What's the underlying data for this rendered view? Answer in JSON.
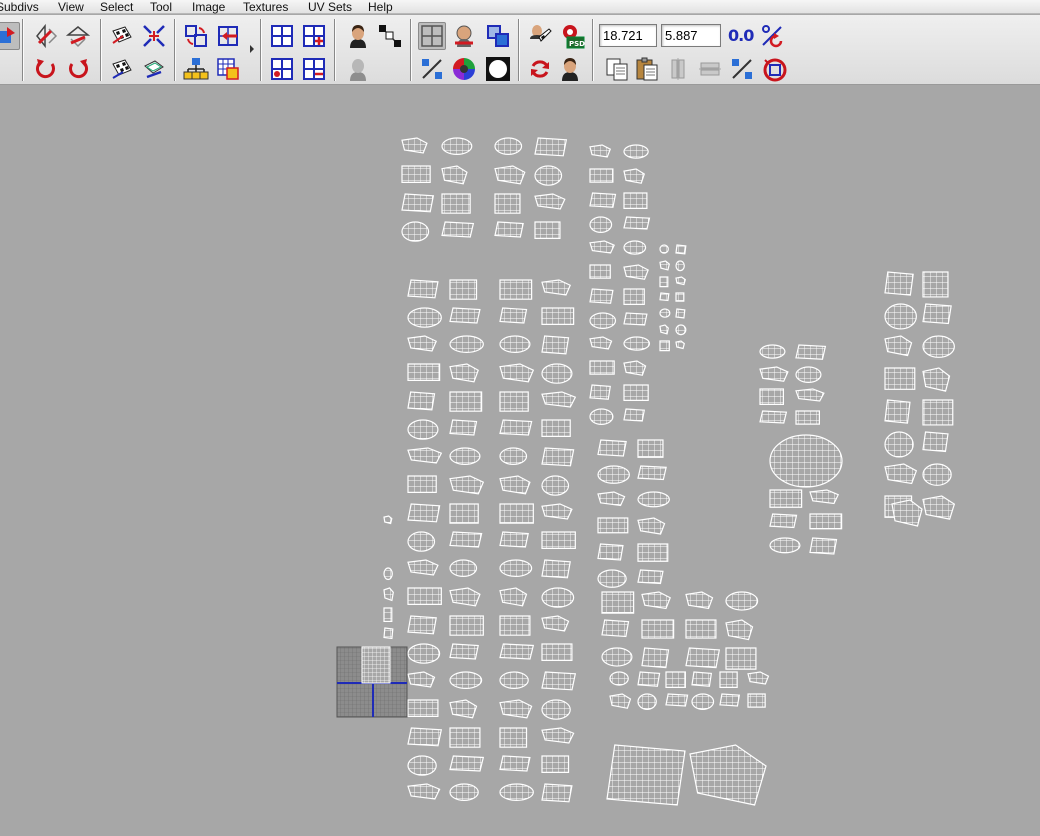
{
  "menubar": {
    "items": [
      "Subdivs",
      "View",
      "Select",
      "Tool",
      "Image",
      "Textures",
      "UV Sets",
      "Help"
    ]
  },
  "toolbar": {
    "coord_u": "18.721",
    "coord_v": "5.887",
    "value_label": "0.0",
    "icons": {
      "row1": [
        "select-mode-icon",
        "flip-u-icon",
        "flip-v-icon",
        "checker-map-icon",
        "shrink-icon",
        "cycle-uv-icon",
        "move-to-shell-icon",
        "grid-icon",
        "grid-add-icon",
        "portrait-icon",
        "align-icon",
        "grid-view-icon",
        "shaded-icon",
        "layout-icon",
        "texture-paint-icon",
        "photoshop-icon",
        "percent-icon"
      ],
      "row2": [
        "rotate-ccw-icon",
        "rotate-cw-icon",
        "checker-map-2-icon",
        "unfold-icon",
        "hierarchy-icon",
        "grid-select-icon",
        "grid-record-icon",
        "grid-remove-icon",
        "portrait-dim-icon",
        "percent-small-icon",
        "color-wheel-icon",
        "black-dot-icon",
        "reload-icon",
        "portrait-small-icon",
        "copy-icon",
        "paste-icon",
        "distribute-icon",
        "level-icon",
        "percent-2-icon",
        "stop-icon"
      ]
    }
  },
  "colors": {
    "canvas": "#a7a7a7",
    "wire": "#ffffff",
    "accent_blue": "#1f2bb7",
    "accent_red": "#c8141c"
  }
}
